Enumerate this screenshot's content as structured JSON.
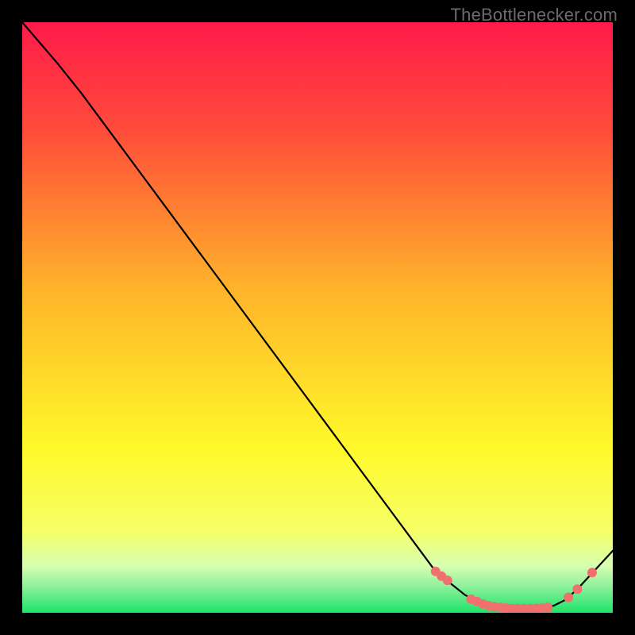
{
  "watermark": "TheBottlenecker.com",
  "colors": {
    "frame": "#000000",
    "line": "#000000",
    "marker": "#f07070",
    "gradient_top": "#ff1a4a",
    "gradient_mid_upper": "#ffb32a",
    "gradient_mid_lower": "#fff92a",
    "gradient_band": "#e8ffa8",
    "gradient_bottom": "#1de36a"
  },
  "chart_data": {
    "type": "line",
    "title": "",
    "xlabel": "",
    "ylabel": "",
    "xlim": [
      0,
      100
    ],
    "ylim": [
      0,
      100
    ],
    "series": [
      {
        "name": "curve",
        "x": [
          0,
          6,
          10,
          20,
          30,
          40,
          50,
          60,
          70,
          75,
          78,
          80,
          82,
          84,
          86,
          88,
          90,
          92,
          94,
          100
        ],
        "y": [
          100,
          93,
          88,
          74.5,
          61,
          47.5,
          34,
          20.5,
          7,
          3,
          1.5,
          1,
          0.8,
          0.7,
          0.7,
          0.8,
          1.2,
          2.2,
          4,
          10.5
        ]
      }
    ],
    "markers": {
      "name": "highlight-points",
      "x": [
        70,
        71,
        72,
        76,
        77,
        78,
        79,
        80,
        81,
        82,
        83,
        84,
        85,
        86,
        87,
        88,
        89,
        92.5,
        94,
        96.5
      ],
      "y": [
        7,
        6.2,
        5.5,
        2.3,
        1.9,
        1.5,
        1.2,
        1.0,
        0.9,
        0.8,
        0.7,
        0.7,
        0.7,
        0.7,
        0.75,
        0.8,
        0.9,
        2.6,
        4.0,
        6.8
      ]
    },
    "annotations": []
  }
}
